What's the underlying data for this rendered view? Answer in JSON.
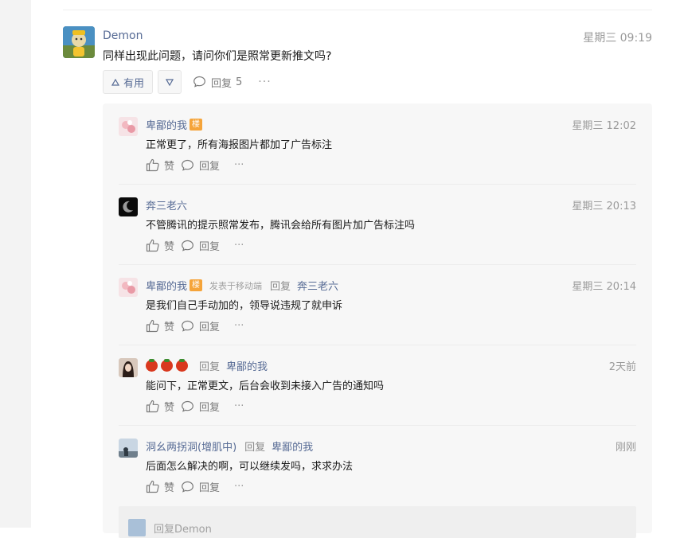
{
  "main_comment": {
    "author": "Demon",
    "time": "星期三 09:19",
    "text": "同样出现此问题，请问你们是照常更新推文吗?",
    "useful_label": "有用",
    "reply_label": "回复",
    "reply_count": "5",
    "more_label": "···"
  },
  "replies": [
    {
      "author": "卑鄙的我",
      "badge": "楼",
      "via": "",
      "reply_word": "",
      "target": "",
      "time": "星期三 12:02",
      "text": "正常更了，所有海报图片都加了广告标注",
      "like_label": "赞",
      "reply_label": "回复",
      "more_label": "···"
    },
    {
      "author": "奔三老六",
      "badge": "",
      "via": "",
      "reply_word": "",
      "target": "",
      "time": "星期三 20:13",
      "text": "不管腾讯的提示照常发布，腾讯会给所有图片加广告标注吗",
      "like_label": "赞",
      "reply_label": "回复",
      "more_label": "···"
    },
    {
      "author": "卑鄙的我",
      "badge": "楼",
      "via": "发表于移动端",
      "reply_word": "回复",
      "target": "奔三老六",
      "time": "星期三 20:14",
      "text": "是我们自己手动加的，领导说违规了就申诉",
      "like_label": "赞",
      "reply_label": "回复",
      "more_label": "···"
    },
    {
      "author": "",
      "badge": "",
      "via": "",
      "reply_word": "回复",
      "target": "卑鄙的我",
      "time": "2天前",
      "text": "能问下，正常更文，后台会收到未接入广告的通知吗",
      "like_label": "赞",
      "reply_label": "回复",
      "more_label": "···"
    },
    {
      "author": "洞幺两拐洞(增肌中)",
      "badge": "",
      "via": "",
      "reply_word": "回复",
      "target": "卑鄙的我",
      "time": "刚刚",
      "text": "后面怎么解决的啊，可以继续发吗，求求办法",
      "like_label": "赞",
      "reply_label": "回复",
      "more_label": "···"
    }
  ],
  "nested_reply_preview": "回复Demon",
  "colors": {
    "link": "#576b95",
    "badge": "#f5a43a",
    "panel": "#f7f7f7"
  },
  "icons": [
    "thumb-up-icon",
    "comment-bubble-icon",
    "triangle-up-icon",
    "triangle-down-icon",
    "tomato-emoji"
  ]
}
